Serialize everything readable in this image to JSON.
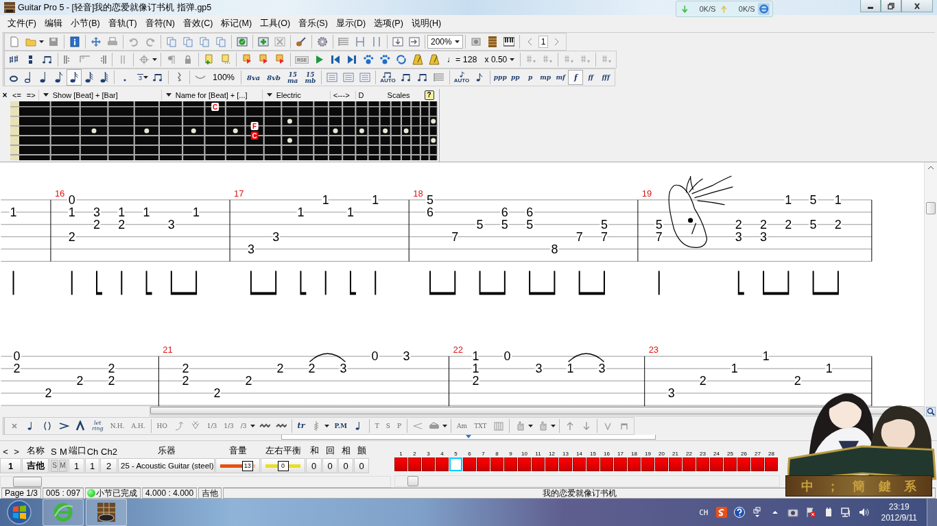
{
  "window": {
    "title": "Guitar Pro 5 - [轻音]我的恋爱就像订书机 指弹.gp5"
  },
  "net_speed": {
    "download": "0K/S",
    "upload": "0K/S"
  },
  "menu": [
    "文件(F)",
    "编辑",
    "小节(B)",
    "音轨(T)",
    "音符(N)",
    "音效(C)",
    "标记(M)",
    "工具(O)",
    "音乐(S)",
    "显示(D)",
    "选项(P)",
    "说明(H)"
  ],
  "toolbar": {
    "zoom": "200%",
    "page": "1",
    "rse": "RSE",
    "tempo": "♩= 128",
    "speed": "x 0.50",
    "tuplet": "3",
    "velocity": "100%",
    "durations": [
      {
        "selected": false
      },
      {
        "selected": false
      },
      {
        "selected": false
      },
      {
        "selected": false
      },
      {
        "selected": true
      },
      {
        "selected": false
      },
      {
        "selected": false
      }
    ],
    "ottava": [
      {
        "label": "8va"
      },
      {
        "label": "8vb"
      },
      {
        "label": "15",
        "sub": "ma"
      },
      {
        "label": "15",
        "sub": "mb"
      }
    ],
    "auto": [
      "AUTO",
      "AUTO"
    ],
    "dynamics": [
      {
        "label": "ppp",
        "selected": false
      },
      {
        "label": "pp",
        "selected": false
      },
      {
        "label": "p",
        "selected": false
      },
      {
        "label": "mp",
        "selected": false
      },
      {
        "label": "mf",
        "selected": false
      },
      {
        "label": "f",
        "selected": true
      },
      {
        "label": "ff",
        "selected": false
      },
      {
        "label": "fff",
        "selected": false
      }
    ]
  },
  "fretboard": {
    "close": "×",
    "prev": "<=",
    "next": "=>",
    "show": "Show [Beat] + [Bar]",
    "name_for": "Name for [Beat] + [...]",
    "type": "Electric",
    "range": "<--->",
    "key": "D",
    "scales": "Scales",
    "help": "?",
    "marks": {
      "string_1": {
        "fret_8": {
          "label": "C",
          "highlighted": false
        }
      },
      "string_3": {
        "fret_10": {
          "label": "F",
          "highlighted": false
        }
      },
      "string_4": {
        "fret_10": {
          "label": "C",
          "highlighted": true
        }
      }
    }
  },
  "score": {
    "systems": [
      {
        "measures": [
          {
            "beats": [
              {
                "kind": "quarter",
                "frets": {
                  "string_2": "1"
                }
              }
            ]
          },
          {
            "number": "16",
            "beats": [
              {
                "kind": "quarter",
                "frets": {
                  "string_1": "0",
                  "string_2": "1",
                  "string_4": "2"
                }
              },
              {
                "kind": "eighth",
                "frets": {
                  "string_2": "3",
                  "string_3": "2"
                }
              },
              {
                "kind": "quarter",
                "frets": {
                  "string_2": "1",
                  "string_3": "2"
                }
              },
              {
                "kind": "eighth",
                "frets": {
                  "string_2": "1"
                }
              },
              {
                "kind": "beam-start",
                "frets": {
                  "string_3": "3"
                }
              },
              {
                "kind": "beam-end",
                "frets": {
                  "string_2": "1"
                }
              }
            ]
          },
          {
            "number": "17",
            "beats": [
              {
                "kind": "beam-start",
                "frets": {
                  "string_5": "3"
                }
              },
              {
                "kind": "beam-end",
                "frets": {
                  "string_4": "3"
                }
              },
              {
                "kind": "eighth",
                "frets": {
                  "string_2": "1"
                }
              },
              {
                "kind": "quarter",
                "frets": {
                  "string_1": "1"
                }
              },
              {
                "kind": "eighth",
                "frets": {
                  "string_2": "1"
                }
              },
              {
                "kind": "quarter",
                "frets": {
                  "string_1": "1"
                }
              }
            ]
          },
          {
            "number": "18",
            "beats": [
              {
                "kind": "beam-start",
                "frets": {
                  "string_1": "5",
                  "string_2": "6"
                }
              },
              {
                "kind": "beam-end",
                "frets": {
                  "string_4": "7"
                }
              },
              {
                "kind": "beam-start",
                "frets": {
                  "string_3": "5"
                }
              },
              {
                "kind": "beam-end",
                "frets": {
                  "string_2": "6",
                  "string_3": "5"
                }
              },
              {
                "kind": "beam-start",
                "frets": {
                  "string_2": "6",
                  "string_3": "5"
                }
              },
              {
                "kind": "beam-end",
                "frets": {
                  "string_5": "8"
                }
              },
              {
                "kind": "beam-start",
                "frets": {
                  "string_4": "7"
                }
              },
              {
                "kind": "beam-end",
                "frets": {
                  "string_3": "5",
                  "string_4": "7"
                }
              }
            ]
          },
          {
            "number": "19",
            "beats": [
              {
                "kind": "quarter",
                "frets": {
                  "string_3": "5",
                  "string_4": "7"
                },
                "doodle": true
              },
              {
                "kind": "eighth",
                "frets": {
                  "string_3": "2",
                  "string_4": "3"
                }
              },
              {
                "kind": "beam-start",
                "frets": {
                  "string_3": "2",
                  "string_4": "3"
                }
              },
              {
                "kind": "beam-end",
                "frets": {
                  "string_1": "1",
                  "string_3": "2"
                }
              },
              {
                "kind": "beam-start",
                "frets": {
                  "string_1": "5",
                  "string_3": "5"
                }
              },
              {
                "kind": "beam-end",
                "frets": {
                  "string_1": "1",
                  "string_3": "2"
                }
              }
            ]
          }
        ]
      },
      {
        "measures": [
          {
            "beats": [
              {
                "frets": {
                  "string_1": "0",
                  "string_2": "2"
                }
              },
              {
                "frets": {
                  "string_4": "2"
                }
              },
              {
                "frets": {
                  "string_3": "2"
                }
              },
              {
                "frets": {
                  "string_2": "2",
                  "string_3": "2"
                }
              }
            ]
          },
          {
            "number": "21",
            "beats": [
              {
                "frets": {
                  "string_2": "2",
                  "string_3": "2"
                }
              },
              {
                "frets": {
                  "string_4": "2"
                }
              },
              {
                "frets": {
                  "string_3": "2"
                }
              },
              {
                "frets": {
                  "string_2": "2"
                }
              },
              {
                "frets": {
                  "string_2": "2"
                },
                "legato": true
              },
              {
                "frets": {
                  "string_2": "3"
                }
              },
              {
                "frets": {
                  "string_1": "0"
                }
              },
              {
                "frets": {
                  "string_1": "3"
                }
              }
            ]
          },
          {
            "number": "22",
            "beats": [
              {
                "frets": {
                  "string_1": "1",
                  "string_2": "1",
                  "string_3": "2"
                }
              },
              {
                "frets": {
                  "string_1": "0"
                }
              },
              {
                "frets": {
                  "string_2": "3"
                }
              },
              {
                "frets": {
                  "string_2": "1"
                },
                "legato": true
              },
              {
                "frets": {
                  "string_2": "3"
                }
              }
            ]
          },
          {
            "number": "23",
            "beats": [
              {
                "frets": {
                  "string_4": "3"
                }
              },
              {
                "frets": {
                  "string_3": "2"
                }
              },
              {
                "frets": {
                  "string_2": "1"
                }
              },
              {
                "frets": {
                  "string_1": "1"
                }
              },
              {
                "frets": {
                  "string_3": "2"
                }
              },
              {
                "frets": {
                  "string_2": "1"
                }
              }
            ]
          }
        ]
      }
    ]
  },
  "effects_toolbar": {
    "let_ring": [
      "let",
      "ring"
    ],
    "nh": "N.H.",
    "ah": "A.H.",
    "ho": "HO",
    "tuplet_a": "1/3",
    "tuplet_b": "1/3",
    "tuplet_c": "/3",
    "trill": "tr",
    "palm_mute": "P.M",
    "tap": "T",
    "slap": "S",
    "pop": "P",
    "text": "TXT",
    "chord": "Am"
  },
  "tracks": {
    "header": {
      "prev": "<",
      "next": ">",
      "name": "名称",
      "solo": "S",
      "mute": "M",
      "port": "端口",
      "channel": "Ch",
      "channel2": "Ch2",
      "instrument": "乐器",
      "volume": "音量",
      "pan": "左右平衡",
      "chorus": "和",
      "reverb": "回",
      "phaser": "相",
      "tremolo": "颤"
    },
    "rows": [
      {
        "number": "1",
        "name": "吉他",
        "solo": {
          "label": "S",
          "on": false
        },
        "mute": {
          "label": "M",
          "on": false
        },
        "port": "1",
        "channel": "1",
        "channel2": "2",
        "instrument": "25 - Acoustic Guitar (steel)",
        "volume": {
          "level": 0.78,
          "reading": "13"
        },
        "pan": {
          "level": 0.5,
          "reading": "0"
        },
        "chorus": "0",
        "reverb": "0",
        "phaser": "0",
        "tremolo": "0"
      }
    ]
  },
  "bars": [
    {
      "number": "1",
      "selected": false
    },
    {
      "number": "2",
      "selected": false
    },
    {
      "number": "3",
      "selected": false
    },
    {
      "number": "4",
      "selected": false
    },
    {
      "number": "5",
      "selected": true
    },
    {
      "number": "6",
      "selected": false
    },
    {
      "number": "7",
      "selected": false
    },
    {
      "number": "8",
      "selected": false
    },
    {
      "number": "9",
      "selected": false
    },
    {
      "number": "10",
      "selected": false
    },
    {
      "number": "11",
      "selected": false
    },
    {
      "number": "12",
      "selected": false
    },
    {
      "number": "13",
      "selected": false
    },
    {
      "number": "14",
      "selected": false
    },
    {
      "number": "15",
      "selected": false
    },
    {
      "number": "16",
      "selected": false
    },
    {
      "number": "17",
      "selected": false
    },
    {
      "number": "18",
      "selected": false
    },
    {
      "number": "19",
      "selected": false
    },
    {
      "number": "20",
      "selected": false
    },
    {
      "number": "21",
      "selected": false
    },
    {
      "number": "22",
      "selected": false
    },
    {
      "number": "23",
      "selected": false
    },
    {
      "number": "24",
      "selected": false
    },
    {
      "number": "25",
      "selected": false
    },
    {
      "number": "26",
      "selected": false
    },
    {
      "number": "27",
      "selected": false
    },
    {
      "number": "28",
      "selected": false
    }
  ],
  "status_bar": {
    "page": "Page 1/3",
    "position": "005 : 097",
    "bar_complete": true,
    "bar_status": "小节已完成",
    "time": "4.000 : 4.000",
    "track": "吉他",
    "song": "我的恋爱就像订书机"
  },
  "taskbar": {
    "apps": [
      {
        "kind": "browser"
      },
      {
        "kind": "guitar-pro"
      }
    ],
    "language": "CH",
    "time": "23:19",
    "date": "2012/9/11"
  },
  "ime_bar": [
    "中",
    "；",
    "簡",
    "鍵",
    "系"
  ]
}
